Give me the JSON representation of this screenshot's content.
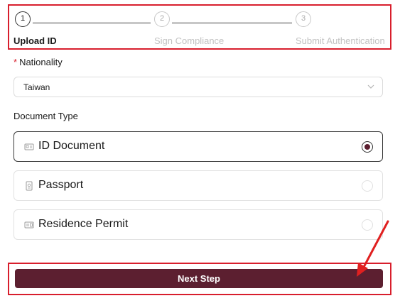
{
  "stepper": {
    "steps": [
      {
        "number": "1",
        "label": "Upload ID",
        "state": "active"
      },
      {
        "number": "2",
        "label": "Sign Compliance",
        "state": "inactive"
      },
      {
        "number": "3",
        "label": "Submit Authentication",
        "state": "inactive"
      }
    ]
  },
  "nationality": {
    "required_mark": "*",
    "label": "Nationality",
    "value": "Taiwan",
    "icon": "chevron-down-icon"
  },
  "document_type": {
    "label": "Document Type",
    "selected": "ID Document",
    "options": [
      {
        "label": "ID Document",
        "icon": "id-card-icon",
        "checked": true
      },
      {
        "label": "Passport",
        "icon": "passport-icon",
        "checked": false
      },
      {
        "label": "Residence Permit",
        "icon": "residence-permit-icon",
        "checked": false
      }
    ]
  },
  "actions": {
    "next_label": "Next Step"
  },
  "colors": {
    "primary": "#5c1f30",
    "highlight": "#d81e2c",
    "required": "#d81e2c"
  }
}
